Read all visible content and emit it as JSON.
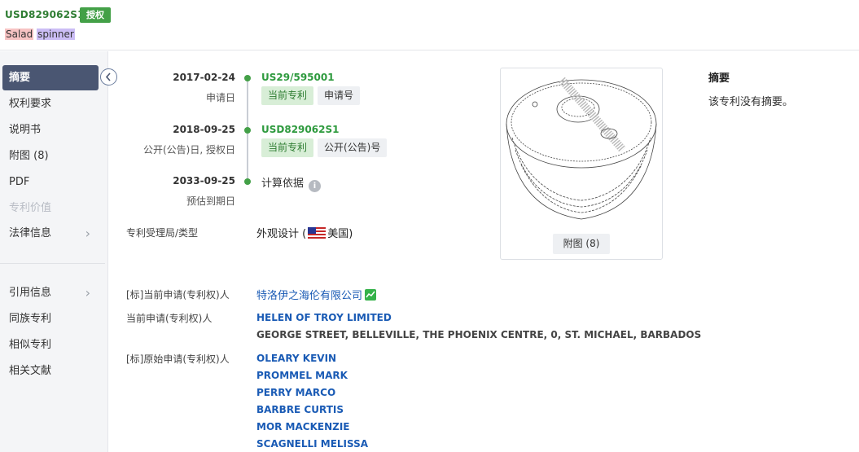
{
  "header": {
    "publication_number": "USD829062S1",
    "status_badge": "授权",
    "title_word1": "Salad",
    "title_word2": "spinner"
  },
  "sidebar": {
    "items": [
      {
        "label": "摘要",
        "active": true
      },
      {
        "label": "权利要求"
      },
      {
        "label": "说明书"
      },
      {
        "label": "附图 (8)"
      },
      {
        "label": "PDF"
      },
      {
        "label": "专利价值",
        "disabled": true
      },
      {
        "label": "法律信息",
        "chevron": "›"
      },
      {
        "label": "引用信息",
        "chevron": "›"
      },
      {
        "label": "同族专利"
      },
      {
        "label": "相似专利"
      },
      {
        "label": "相关文献"
      }
    ],
    "collapse_icon": "chevron-left-icon"
  },
  "timeline": {
    "events": [
      {
        "date": "2017-02-24",
        "label": "申请日",
        "code": "US29/595001",
        "tag_current": "当前专利",
        "tag_type": "申请号"
      },
      {
        "date": "2018-09-25",
        "label": "公开(公告)日, 授权日",
        "code": "USD829062S1",
        "tag_current": "当前专利",
        "tag_type": "公开(公告)号"
      },
      {
        "date": "2033-09-25",
        "label": "预估到期日",
        "calc_text": "计算依据",
        "info_icon": "i"
      }
    ]
  },
  "fields": {
    "office_type_label": "专利受理局/类型",
    "office_type_value_a": "外观设计 (",
    "office_type_value_b": "美国)",
    "std_current_applicant_label": "[标]当前申请(专利权)人",
    "std_current_applicant_value": "特洛伊之海伦有限公司",
    "current_applicant_label": "当前申请(专利权)人",
    "current_applicant_name": "HELEN OF TROY LIMITED",
    "current_applicant_address": "GEORGE STREET, BELLEVILLE, THE PHOENIX CENTRE, 0, ST. MICHAEL, BARBADOS",
    "std_original_applicant_label": "[标]原始申请(专利权)人",
    "original_applicants": [
      "OLEARY KEVIN",
      "PROMMEL MARK",
      "PERRY MARCO",
      "BARBRE CURTIS",
      "MOR MACKENZIE",
      "SCAGNELLI MELISSA"
    ]
  },
  "image_card": {
    "button_label": "附图 (8)"
  },
  "abstract": {
    "heading": "摘要",
    "text": "该专利没有摘要。"
  },
  "colors": {
    "accent_green": "#43a047",
    "link_blue": "#1a5bb5",
    "sidebar_active": "#4a5672"
  }
}
